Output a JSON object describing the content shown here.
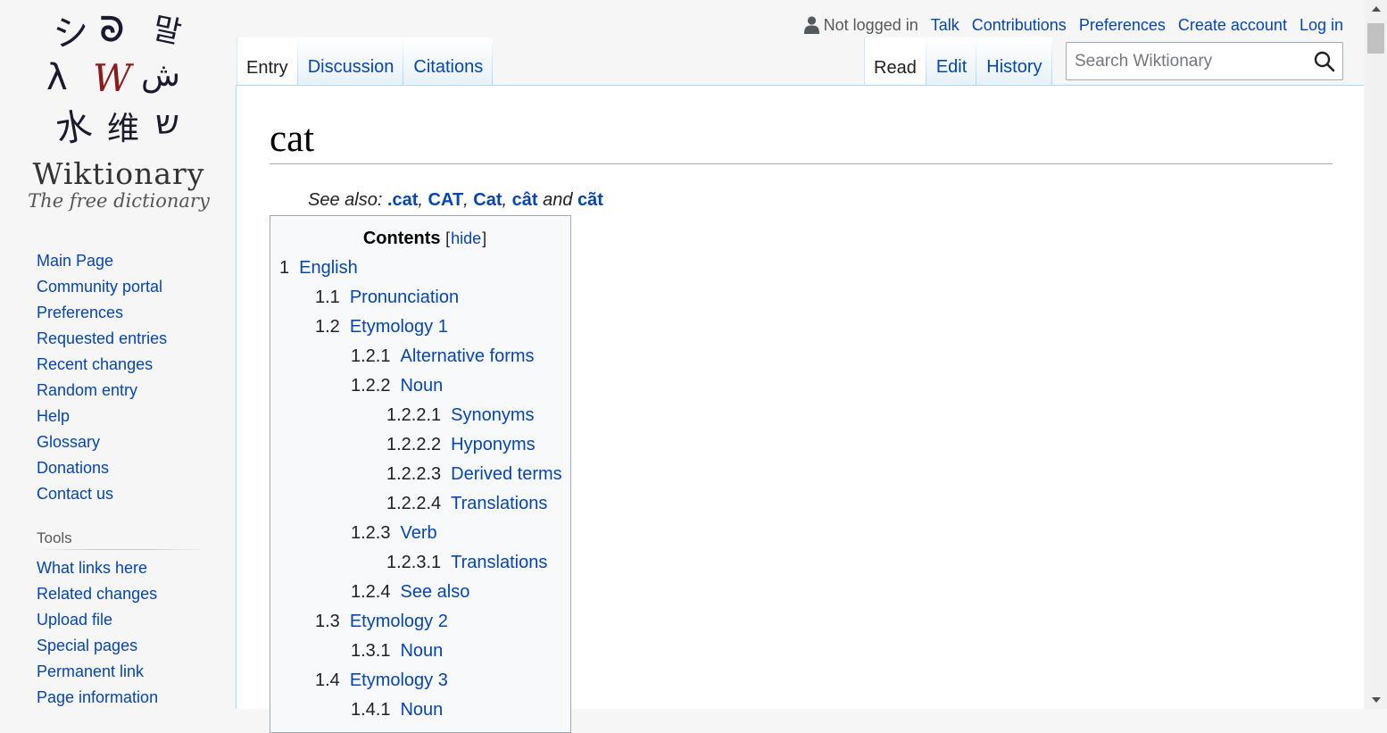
{
  "logo": {
    "glyphs": [
      "シ",
      "ᘐ",
      "말",
      "λ",
      "W",
      "ش",
      "水",
      "维",
      "ש"
    ],
    "wordmark": "Wiktionary",
    "tagline": "The free dictionary"
  },
  "sidebar": {
    "navigation": [
      {
        "label": "Main Page"
      },
      {
        "label": "Community portal"
      },
      {
        "label": "Preferences"
      },
      {
        "label": "Requested entries"
      },
      {
        "label": "Recent changes"
      },
      {
        "label": "Random entry"
      },
      {
        "label": "Help"
      },
      {
        "label": "Glossary"
      },
      {
        "label": "Donations"
      },
      {
        "label": "Contact us"
      }
    ],
    "tools_heading": "Tools",
    "tools": [
      {
        "label": "What links here"
      },
      {
        "label": "Related changes"
      },
      {
        "label": "Upload file"
      },
      {
        "label": "Special pages"
      },
      {
        "label": "Permanent link"
      },
      {
        "label": "Page information"
      }
    ]
  },
  "personal": {
    "not_logged_in": "Not logged in",
    "talk": "Talk",
    "contributions": "Contributions",
    "preferences": "Preferences",
    "create_account": "Create account",
    "log_in": "Log in"
  },
  "tabs": {
    "left": [
      "Entry",
      "Discussion",
      "Citations"
    ],
    "right": [
      "Read",
      "Edit",
      "History"
    ]
  },
  "search": {
    "placeholder": "Search Wiktionary"
  },
  "page": {
    "title": "cat",
    "see_also_prefix": "See also: ",
    "see_also": [
      ".cat",
      "CAT",
      "Cat",
      "cât",
      "cãt"
    ],
    "sep1": ", ",
    "sep2": ", ",
    "sep3": ", ",
    "and": " and "
  },
  "toc": {
    "title": "Contents",
    "hide": "hide",
    "items": [
      {
        "level": 1,
        "number": "1",
        "text": "English"
      },
      {
        "level": 2,
        "number": "1.1",
        "text": "Pronunciation"
      },
      {
        "level": 2,
        "number": "1.2",
        "text": "Etymology 1"
      },
      {
        "level": 3,
        "number": "1.2.1",
        "text": "Alternative forms"
      },
      {
        "level": 3,
        "number": "1.2.2",
        "text": "Noun"
      },
      {
        "level": 4,
        "number": "1.2.2.1",
        "text": "Synonyms"
      },
      {
        "level": 4,
        "number": "1.2.2.2",
        "text": "Hyponyms"
      },
      {
        "level": 4,
        "number": "1.2.2.3",
        "text": "Derived terms"
      },
      {
        "level": 4,
        "number": "1.2.2.4",
        "text": "Translations"
      },
      {
        "level": 3,
        "number": "1.2.3",
        "text": "Verb"
      },
      {
        "level": 4,
        "number": "1.2.3.1",
        "text": "Translations"
      },
      {
        "level": 3,
        "number": "1.2.4",
        "text": "See also"
      },
      {
        "level": 2,
        "number": "1.3",
        "text": "Etymology 2"
      },
      {
        "level": 3,
        "number": "1.3.1",
        "text": "Noun"
      },
      {
        "level": 2,
        "number": "1.4",
        "text": "Etymology 3"
      },
      {
        "level": 3,
        "number": "1.4.1",
        "text": "Noun"
      }
    ]
  },
  "colors": {
    "link": "#0645ad",
    "logo_accent": "#8b1a1a",
    "text": "#202122"
  }
}
